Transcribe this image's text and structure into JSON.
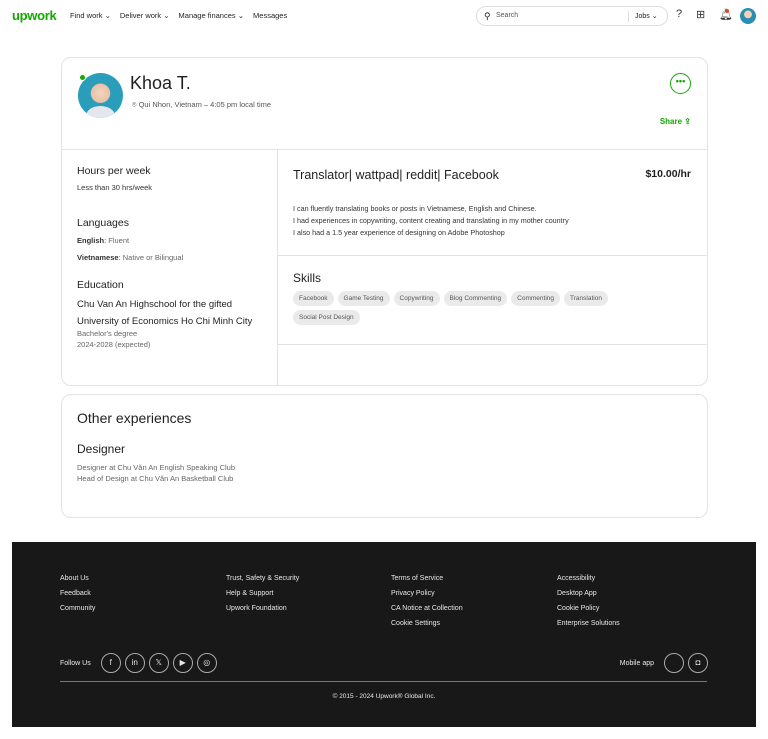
{
  "nav": {
    "logo": "upwork",
    "links": [
      "Find work ⌄",
      "Deliver work ⌄",
      "Manage finances ⌄",
      "Messages"
    ],
    "search_placeholder": "Search",
    "search_scope": "Jobs ⌄"
  },
  "profile": {
    "name": "Khoa T.",
    "location": "Qui Nhon, Vietnam – 4:05 pm local time",
    "share": "Share",
    "more": "•••",
    "hours_title": "Hours per week",
    "hours_value": "Less than 30 hrs/week",
    "languages_title": "Languages",
    "languages": [
      {
        "name": "English",
        "level": "Fluent"
      },
      {
        "name": "Vietnamese",
        "level": "Native or Bilingual"
      }
    ],
    "education_title": "Education",
    "education": [
      {
        "school": "Chu Van An Highschool for the gifted"
      },
      {
        "school": "University of Economics Ho Chi Minh City",
        "degree": "Bachelor's degree",
        "years": "2024-2028 (expected)"
      }
    ],
    "title": "Translator| wattpad| reddit| Facebook",
    "rate": "$10.00/hr",
    "description": [
      "I can fluently translating books or posts in Vietnamese, English and Chinese.",
      "I had experiences in copywriting, content creating and translating in my mother country",
      "I also had a 1.5 year experience of designing on Adobe Photoshop"
    ],
    "skills_title": "Skills",
    "skills": [
      "Facebook",
      "Game Testing",
      "Copywriting",
      "Blog Commenting",
      "Commenting",
      "Translation",
      "Social Post Design"
    ]
  },
  "other": {
    "title": "Other experiences",
    "role": "Designer",
    "lines": [
      "Designer at Chu Văn An English Speaking Club",
      "Head of Design at Chu Văn An Basketball Club"
    ]
  },
  "footer": {
    "cols": [
      [
        "About Us",
        "Feedback",
        "Community"
      ],
      [
        "Trust, Safety & Security",
        "Help & Support",
        "Upwork Foundation"
      ],
      [
        "Terms of Service",
        "Privacy Policy",
        "CA Notice at Collection",
        "Cookie Settings"
      ],
      [
        "Accessibility",
        "Desktop App",
        "Cookie Policy",
        "Enterprise Solutions"
      ]
    ],
    "follow": "Follow Us",
    "mobile": "Mobile app",
    "copyright": "© 2015 - 2024 Upwork® Global Inc."
  }
}
